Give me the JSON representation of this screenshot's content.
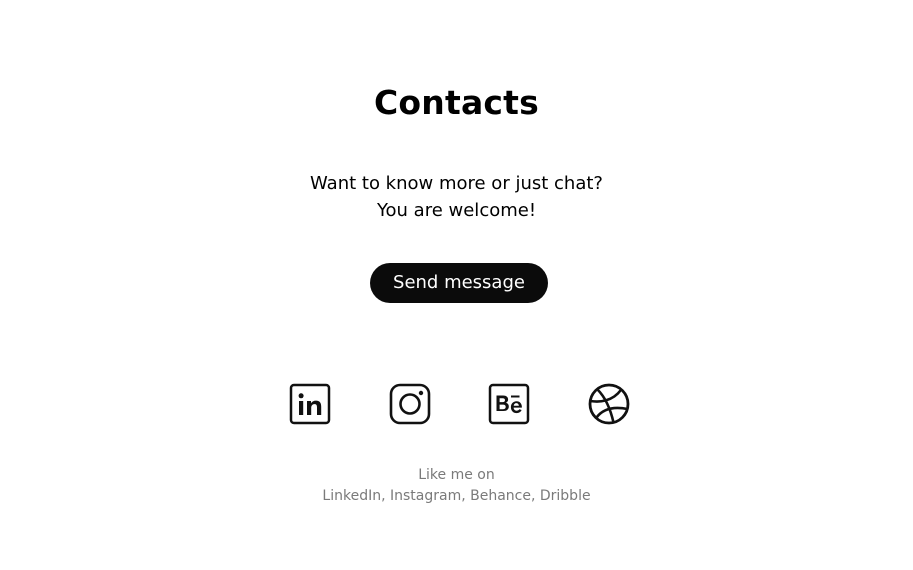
{
  "contacts": {
    "title": "Contacts",
    "intro_line1": "Want to know more or just chat?",
    "intro_line2": "You are welcome!",
    "send_button": "Send message"
  },
  "social": {
    "items": [
      {
        "name": "LinkedIn",
        "icon": "linkedin-icon"
      },
      {
        "name": "Instagram",
        "icon": "instagram-icon"
      },
      {
        "name": "Behance",
        "icon": "behance-icon"
      },
      {
        "name": "Dribbble",
        "icon": "dribbble-icon"
      }
    ],
    "caption_line1": "Like me on",
    "caption_line2": "LinkedIn, Instagram, Behance, Dribble"
  },
  "colors": {
    "background": "#ffffff",
    "text": "#000000",
    "button": "#0b0b0b",
    "caption": "#7a7a7a"
  }
}
